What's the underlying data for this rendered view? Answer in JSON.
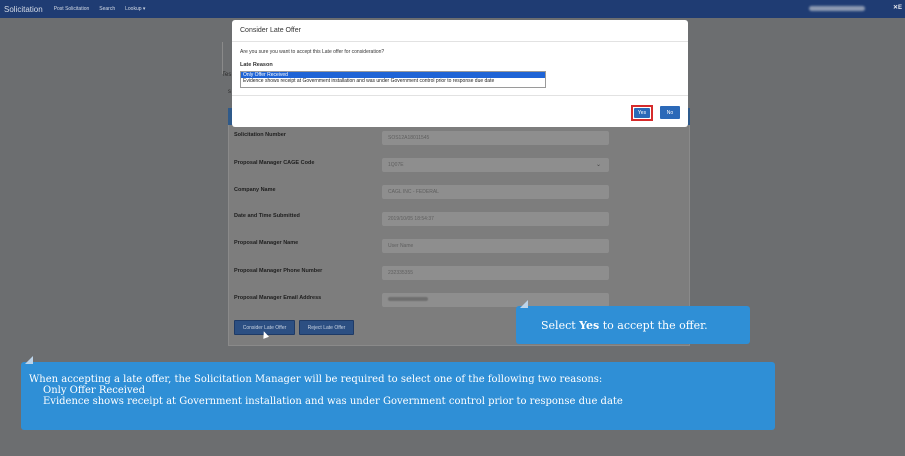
{
  "navbar": {
    "brand": "Solicitation",
    "items": [
      "Post Solicitation",
      "Search",
      "Lookup ▾"
    ]
  },
  "page": {
    "side_text_1": "Tes",
    "side_text_2": "s",
    "rows": [
      {
        "label": "Solicitation Number",
        "value": "SOS12A18011545"
      },
      {
        "label": "Proposal Manager CAGE Code",
        "value": "1Q07E"
      },
      {
        "label": "Company Name",
        "value": "CAGL INC - FEDERAL"
      },
      {
        "label": "Date and Time Submitted",
        "value": "2019/10/05 18:54:37"
      },
      {
        "label": "Proposal Manager Name",
        "value": "User Name"
      },
      {
        "label": "Proposal Manager Phone Number",
        "value": "232335355"
      },
      {
        "label": "Proposal Manager Email Address",
        "value": ""
      }
    ],
    "consider_btn": "Consider Late Offer",
    "reject_btn": "Reject Late Offer"
  },
  "modal": {
    "title": "Consider Late Offer",
    "question": "Are you sure you want to accept this Late offer for consideration?",
    "reason_label": "Late Reason",
    "reasons": [
      "Only Offer Received",
      "Evidence shows receipt at Government installation and was under Government control prior to response due date"
    ],
    "selected_reason": 0,
    "yes": "Yes",
    "no": "No"
  },
  "callout_small": {
    "prefix": "Select ",
    "bold": "Yes",
    "suffix": " to accept the offer."
  },
  "callout_big": {
    "line1": "When accepting a late offer, the Solicitation Manager will be required to select one of the following two reasons:",
    "line2": "Only Offer Received",
    "line3": "Evidence shows receipt at Government installation and was under Government control prior to response due date"
  },
  "colors": {
    "navbar": "#1f3c73",
    "callout": "#2f8fd6",
    "primary_button": "#2b69b8",
    "highlight": "#d62b2b"
  }
}
